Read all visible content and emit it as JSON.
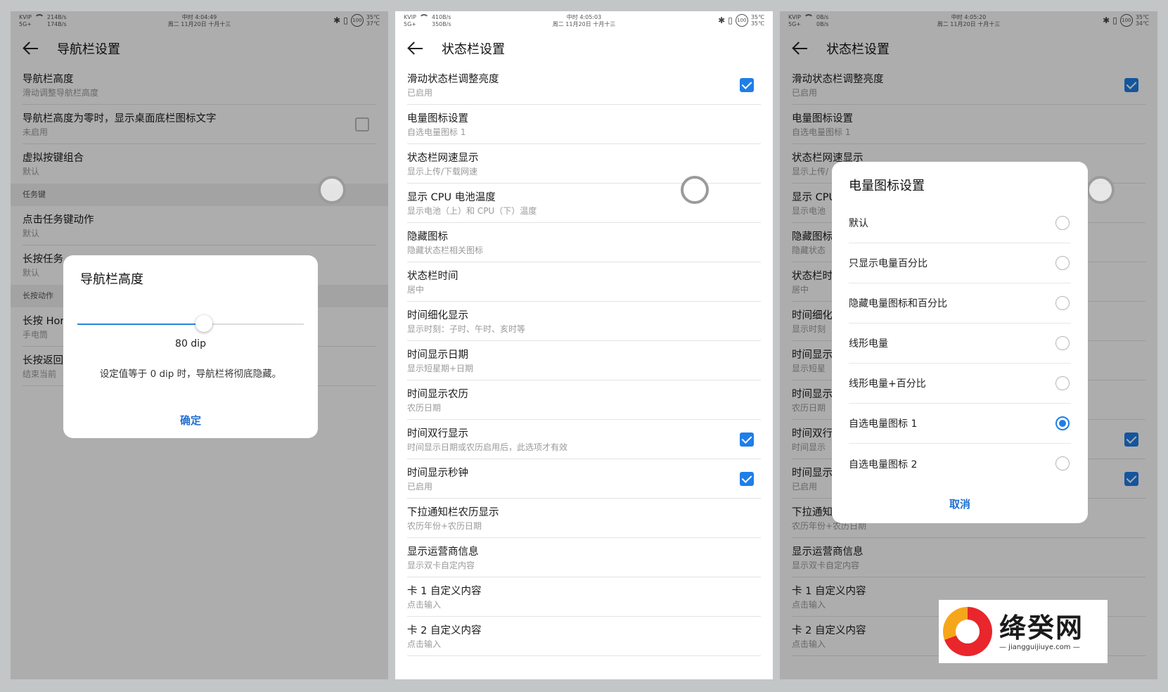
{
  "statusbar": {
    "carrier": "KVIP",
    "signal": "5G+",
    "time_label": "中时",
    "date_line": "周二 11月20日 十月十三",
    "battery": "100",
    "p1": {
      "up": "214B/s",
      "down": "174B/s",
      "time": "4:04:49",
      "temp1": "35℃",
      "temp2": "37℃"
    },
    "p2": {
      "up": "410B/s",
      "down": "350B/s",
      "time": "4:05:03",
      "temp1": "35℃",
      "temp2": "35℃"
    },
    "p3": {
      "up": "0B/s",
      "down": "0B/s",
      "time": "4:05:20",
      "temp1": "35℃",
      "temp2": "34℃"
    }
  },
  "panel1": {
    "title": "导航栏设置",
    "items": [
      {
        "title": "导航栏高度",
        "sub": "滑动调整导航栏高度"
      },
      {
        "title": "导航栏高度为零时，显示桌面底栏图标文字",
        "sub": "未启用"
      },
      {
        "title": "虚拟按键组合",
        "sub": "默认"
      },
      {
        "title": "点击任务键动作",
        "sub": "默认"
      },
      {
        "title": "长按任务",
        "sub": "默认"
      },
      {
        "title": "长按 Hor",
        "sub": "手电筒"
      },
      {
        "title": "长按返回",
        "sub": "结束当前"
      }
    ],
    "section_task": "任务键",
    "section_long": "长按动作",
    "dialog": {
      "title": "导航栏高度",
      "value_label": "80 dip",
      "note": "设定值等于 0 dip 时，导航栏将彻底隐藏。",
      "confirm": "确定",
      "slider_fraction": 0.56
    }
  },
  "panel2": {
    "title": "状态栏设置",
    "items": [
      {
        "title": "滑动状态栏调整亮度",
        "sub": "已启用",
        "checked": true
      },
      {
        "title": "电量图标设置",
        "sub": "自选电量图标 1"
      },
      {
        "title": "状态栏网速显示",
        "sub": "显示上传/下载网速"
      },
      {
        "title": "显示 CPU 电池温度",
        "sub": "显示电池（上）和 CPU（下）温度"
      },
      {
        "title": "隐藏图标",
        "sub": "隐藏状态栏相关图标"
      },
      {
        "title": "状态栏时间",
        "sub": "居中"
      },
      {
        "title": "时间细化显示",
        "sub": "显示时刻：子时、午时、亥时等"
      },
      {
        "title": "时间显示日期",
        "sub": "显示短星期+日期"
      },
      {
        "title": "时间显示农历",
        "sub": "农历日期"
      },
      {
        "title": "时间双行显示",
        "sub": "时间显示日期或农历启用后，此选项才有效",
        "checked": true
      },
      {
        "title": "时间显示秒钟",
        "sub": "已启用",
        "checked": true
      },
      {
        "title": "下拉通知栏农历显示",
        "sub": "农历年份+农历日期"
      },
      {
        "title": "显示运营商信息",
        "sub": "显示双卡自定内容"
      },
      {
        "title": "卡 1 自定义内容",
        "sub": "点击输入"
      },
      {
        "title": "卡 2 自定义内容",
        "sub": "点击输入"
      }
    ]
  },
  "panel3": {
    "title": "状态栏设置",
    "items": [
      {
        "title": "滑动状态栏调整亮度",
        "sub": "已启用"
      },
      {
        "title": "电量图标设置",
        "sub": "自选电量图标 1"
      },
      {
        "title": "状态栏网速显示",
        "sub": "显示上传/"
      },
      {
        "title": "显示 CPU",
        "sub": "显示电池"
      },
      {
        "title": "隐藏图标",
        "sub": "隐藏状态"
      },
      {
        "title": "状态栏时",
        "sub": "居中"
      },
      {
        "title": "时间细化",
        "sub": "显示时刻"
      },
      {
        "title": "时间显示",
        "sub": "显示短星"
      },
      {
        "title": "时间显示",
        "sub": "农历日期"
      },
      {
        "title": "时间双行",
        "sub": "时间显示"
      },
      {
        "title": "时间显示",
        "sub": "已启用"
      },
      {
        "title": "下拉通知",
        "sub": "农历年份+农历日期"
      },
      {
        "title": "显示运营商信息",
        "sub": "显示双卡自定内容"
      },
      {
        "title": "卡 1 自定义内容",
        "sub": "点击输入"
      },
      {
        "title": "卡 2 自定义内容",
        "sub": "点击输入"
      }
    ],
    "dialog": {
      "title": "电量图标设置",
      "options": [
        "默认",
        "只显示电量百分比",
        "隐藏电量图标和百分比",
        "线形电量",
        "线形电量+百分比",
        "自选电量图标 1",
        "自选电量图标 2"
      ],
      "selected_index": 5,
      "cancel": "取消"
    }
  },
  "watermark": {
    "name": "绛癸网",
    "url": "— jiangguijiuye.com —"
  },
  "colors": {
    "accent": "#1f7ee8",
    "dim_overlay": "rgba(0,0,0,0.32)"
  }
}
